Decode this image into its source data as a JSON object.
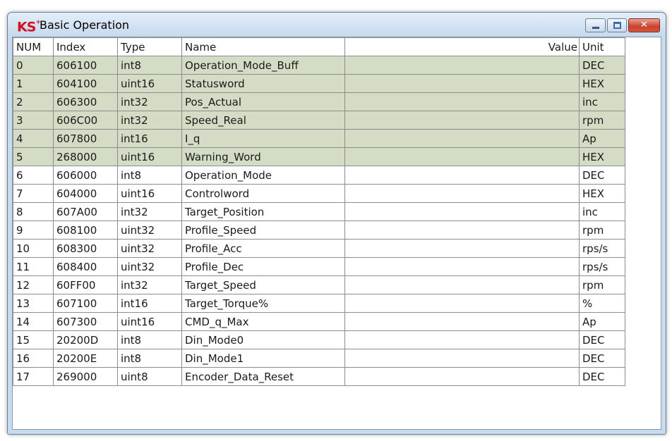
{
  "window": {
    "title": "Basic Operation",
    "icon_text": "KS",
    "icon_sup": "+",
    "close_glyph": "✕"
  },
  "colors": {
    "highlight_row": "#d5dcc6",
    "titlebar": "#c5d9ee",
    "close_button": "#c8412c"
  },
  "table": {
    "headers": [
      "NUM",
      "Index",
      "Type",
      "Name",
      "Value",
      "Unit"
    ],
    "rows": [
      {
        "num": "0",
        "index": "606100",
        "type": "int8",
        "name": "Operation_Mode_Buff",
        "value": "",
        "unit": "DEC",
        "highlighted": true
      },
      {
        "num": "1",
        "index": "604100",
        "type": "uint16",
        "name": "Statusword",
        "value": "",
        "unit": "HEX",
        "highlighted": true
      },
      {
        "num": "2",
        "index": "606300",
        "type": "int32",
        "name": "Pos_Actual",
        "value": "",
        "unit": "inc",
        "highlighted": true
      },
      {
        "num": "3",
        "index": "606C00",
        "type": "int32",
        "name": "Speed_Real",
        "value": "",
        "unit": "rpm",
        "highlighted": true
      },
      {
        "num": "4",
        "index": "607800",
        "type": "int16",
        "name": "I_q",
        "value": "",
        "unit": "Ap",
        "highlighted": true
      },
      {
        "num": "5",
        "index": "268000",
        "type": "uint16",
        "name": "Warning_Word",
        "value": "",
        "unit": "HEX",
        "highlighted": true
      },
      {
        "num": "6",
        "index": "606000",
        "type": "int8",
        "name": "Operation_Mode",
        "value": "",
        "unit": "DEC",
        "highlighted": false
      },
      {
        "num": "7",
        "index": "604000",
        "type": "uint16",
        "name": "Controlword",
        "value": "",
        "unit": "HEX",
        "highlighted": false
      },
      {
        "num": "8",
        "index": "607A00",
        "type": "int32",
        "name": "Target_Position",
        "value": "",
        "unit": "inc",
        "highlighted": false
      },
      {
        "num": "9",
        "index": "608100",
        "type": "uint32",
        "name": "Profile_Speed",
        "value": "",
        "unit": "rpm",
        "highlighted": false
      },
      {
        "num": "10",
        "index": "608300",
        "type": "uint32",
        "name": "Profile_Acc",
        "value": "",
        "unit": "rps/s",
        "highlighted": false
      },
      {
        "num": "11",
        "index": "608400",
        "type": "uint32",
        "name": "Profile_Dec",
        "value": "",
        "unit": "rps/s",
        "highlighted": false
      },
      {
        "num": "12",
        "index": "60FF00",
        "type": "int32",
        "name": "Target_Speed",
        "value": "",
        "unit": "rpm",
        "highlighted": false
      },
      {
        "num": "13",
        "index": "607100",
        "type": "int16",
        "name": "Target_Torque%",
        "value": "",
        "unit": "%",
        "highlighted": false
      },
      {
        "num": "14",
        "index": "607300",
        "type": "uint16",
        "name": "CMD_q_Max",
        "value": "",
        "unit": "Ap",
        "highlighted": false
      },
      {
        "num": "15",
        "index": "20200D",
        "type": "int8",
        "name": "Din_Mode0",
        "value": "",
        "unit": "DEC",
        "highlighted": false
      },
      {
        "num": "16",
        "index": "20200E",
        "type": "int8",
        "name": "Din_Mode1",
        "value": "",
        "unit": "DEC",
        "highlighted": false
      },
      {
        "num": "17",
        "index": "269000",
        "type": "uint8",
        "name": "Encoder_Data_Reset",
        "value": "",
        "unit": "DEC",
        "highlighted": false
      }
    ]
  }
}
